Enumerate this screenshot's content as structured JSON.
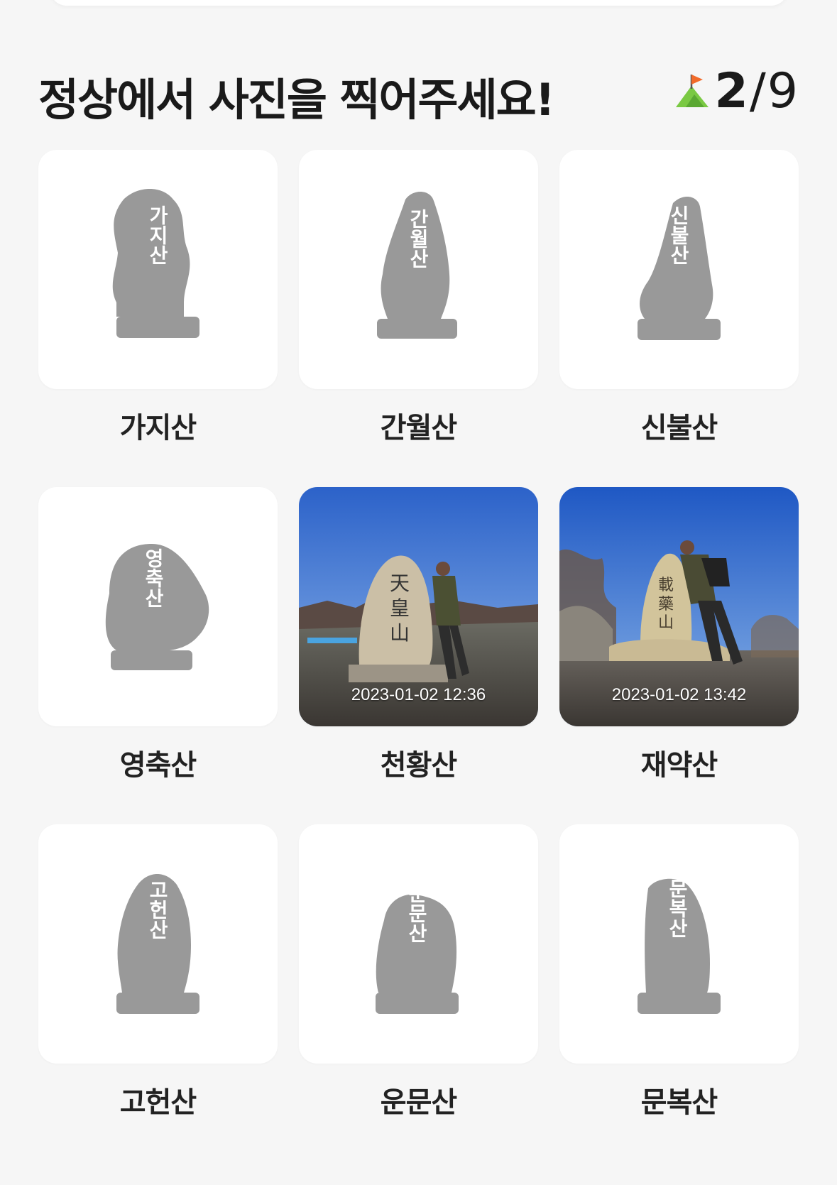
{
  "header": {
    "title": "정상에서 사진을 찍어주세요!",
    "progress_current": "2",
    "progress_separator": "/",
    "progress_total": "9",
    "progress_icon": "summit-flag-icon"
  },
  "colors": {
    "background": "#f6f6f6",
    "card": "#ffffff",
    "stone_placeholder": "#999999",
    "flag_orange": "#f26b2a",
    "mountain_green": "#7ac943"
  },
  "mountains": [
    {
      "name": "가지산",
      "engraving": "가지산",
      "captured": false
    },
    {
      "name": "간월산",
      "engraving": "간월산",
      "captured": false
    },
    {
      "name": "신불산",
      "engraving": "신불산",
      "captured": false
    },
    {
      "name": "영축산",
      "engraving": "영축산",
      "captured": false
    },
    {
      "name": "천황산",
      "engraving": "天皇山",
      "captured": true,
      "timestamp": "2023-01-02 12:36"
    },
    {
      "name": "재약산",
      "engraving": "載藥山",
      "captured": true,
      "timestamp": "2023-01-02 13:42"
    },
    {
      "name": "고헌산",
      "engraving": "고헌산",
      "captured": false
    },
    {
      "name": "운문산",
      "engraving": "운문산",
      "captured": false
    },
    {
      "name": "문복산",
      "engraving": "문복산",
      "captured": false
    }
  ]
}
